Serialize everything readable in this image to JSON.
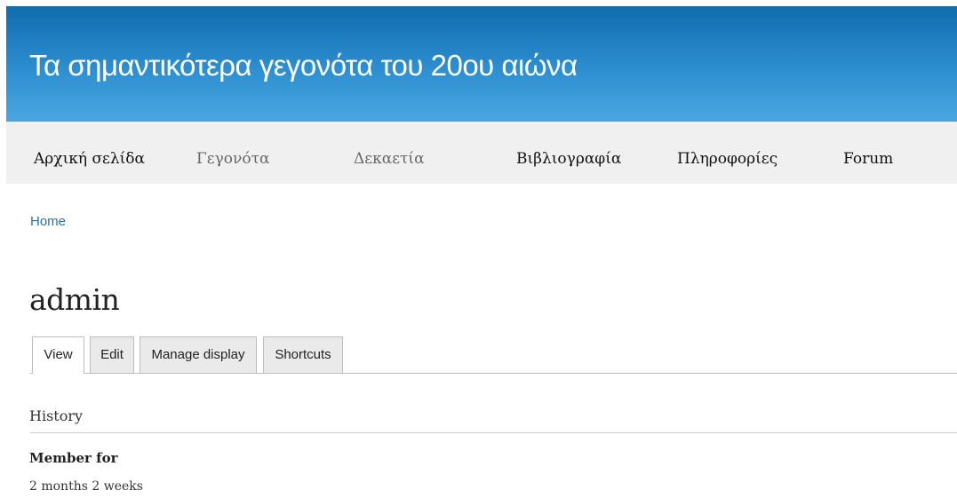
{
  "header": {
    "site_title": "Τα σημαντικότερα γεγονότα του 20ου αιώνα",
    "background_color": "#2d8fd0"
  },
  "nav": {
    "items": [
      {
        "label": "Αρχική σελίδα"
      },
      {
        "label": "Γεγονότα"
      },
      {
        "label": "Δεκαετία"
      },
      {
        "label": "Βιβλιογραφία"
      },
      {
        "label": "Πληροφορίες"
      },
      {
        "label": "Forum"
      }
    ]
  },
  "breadcrumb": {
    "home": "Home"
  },
  "page": {
    "title": "admin"
  },
  "tabs": [
    {
      "label": "View",
      "active": true
    },
    {
      "label": "Edit",
      "active": false
    },
    {
      "label": "Manage display",
      "active": false
    },
    {
      "label": "Shortcuts",
      "active": false
    }
  ],
  "history": {
    "heading": "History",
    "member_for_label": "Member for",
    "member_for_value": "2 months 2 weeks"
  },
  "colors": {
    "link": "#2a6fa8",
    "nav_bg": "#f0f0f0"
  }
}
